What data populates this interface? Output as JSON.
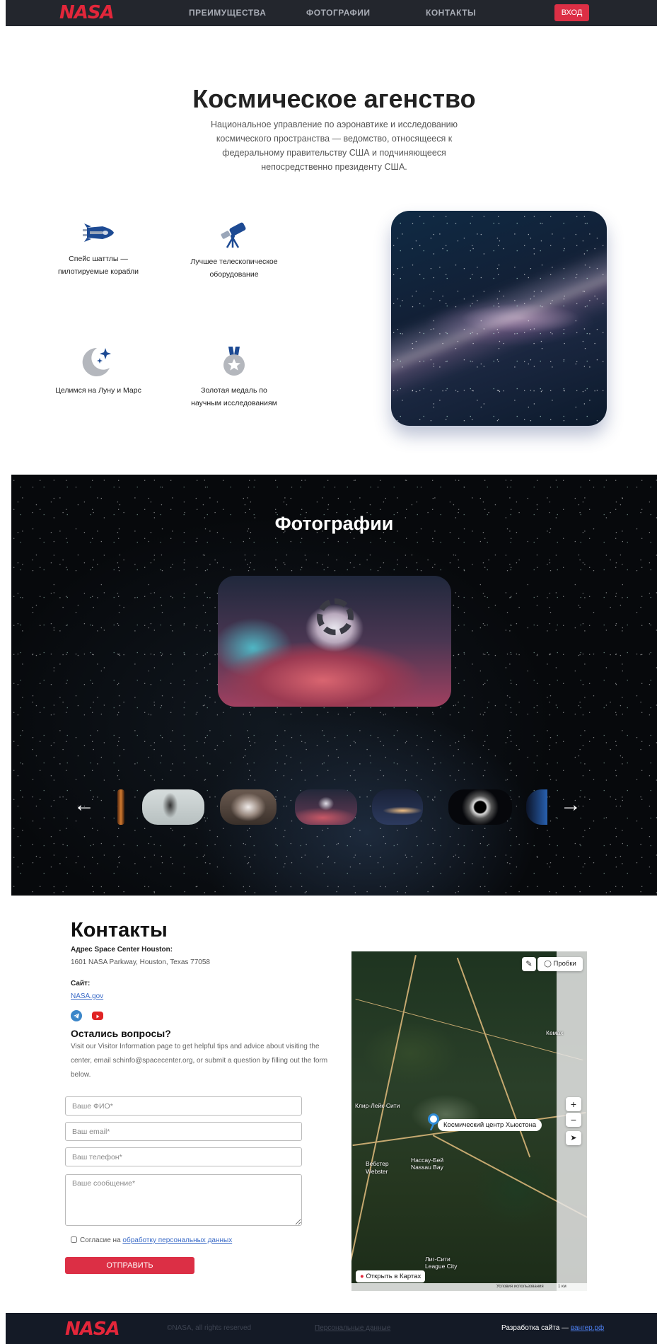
{
  "header": {
    "logo": "NASA",
    "nav": [
      "ПРЕИМУЩЕСТВА",
      "ФОТОГРАФИИ",
      "КОНТАКТЫ"
    ],
    "login_label": "ВХОД"
  },
  "hero": {
    "title": "Космическое агенство",
    "subtitle": "Национальное управление по аэронавтике и исследованию космического пространства — ведомство, относящееся к федеральному правительству США и подчиняющееся непосредственно президенту США.",
    "features": [
      {
        "icon": "space-shuttle-icon",
        "label": "Спейс шаттлы — пилотируемые корабли"
      },
      {
        "icon": "telescope-icon",
        "label": "Лучшее телескопическое оборудование"
      },
      {
        "icon": "moon-stars-icon",
        "label": "Целимся на Луну и Марс"
      },
      {
        "icon": "medal-icon",
        "label": "Золотая медаль по научным исследованиям"
      }
    ]
  },
  "photos": {
    "title": "Фотографии",
    "prev_icon": "arrow-left-icon",
    "next_icon": "arrow-right-icon"
  },
  "contacts": {
    "title": "Контакты",
    "address_label": "Адрес Space Center Houston:",
    "address": "1601 NASA Parkway, Houston, Texas 77058",
    "site_label": "Сайт:",
    "site_link": "NASA.gov",
    "social_icons": [
      "telegram-icon",
      "youtube-icon"
    ],
    "questions_title": "Остались вопросы?",
    "questions_text": "Visit our Visitor Information page to get helpful tips and advice about visiting the center, email schinfo@spacecenter.org, or submit a question by filling out the form below.",
    "form": {
      "name_placeholder": "Ваше ФИО*",
      "email_placeholder": "Ваш email*",
      "phone_placeholder": "Ваш телефон*",
      "message_placeholder": "Ваше сообщение*",
      "consent_text": "Согласие на ",
      "consent_link": "обработку персональных данных",
      "submit_label": "ОТПРАВИТЬ"
    }
  },
  "map": {
    "traffic_label": "Пробки",
    "marker_label": "Космический центр Хьюстона",
    "places": [
      "Клир-Лейк-Сити",
      "Вебстер",
      "Нассау-Бей",
      "Лиг-Сити"
    ],
    "places_partial": [
      "Webster",
      "Nassau Bay",
      "League City",
      "Кемах"
    ],
    "zoom_in": "+",
    "zoom_out": "−",
    "open_label": "Открыть в Картах",
    "terms": "Условия использования",
    "scale": "1 км"
  },
  "footer": {
    "logo": "NASA",
    "copyright": "©NASA, all rights reserved",
    "personal_data": "Персональные данные",
    "dev_text": "Разработка сайта — ",
    "dev_link": "вангер.рф"
  },
  "colors": {
    "accent": "#dc2f45",
    "header_bg": "#23262d",
    "footer_bg": "#141a26",
    "icon_blue": "#1d4a93"
  }
}
